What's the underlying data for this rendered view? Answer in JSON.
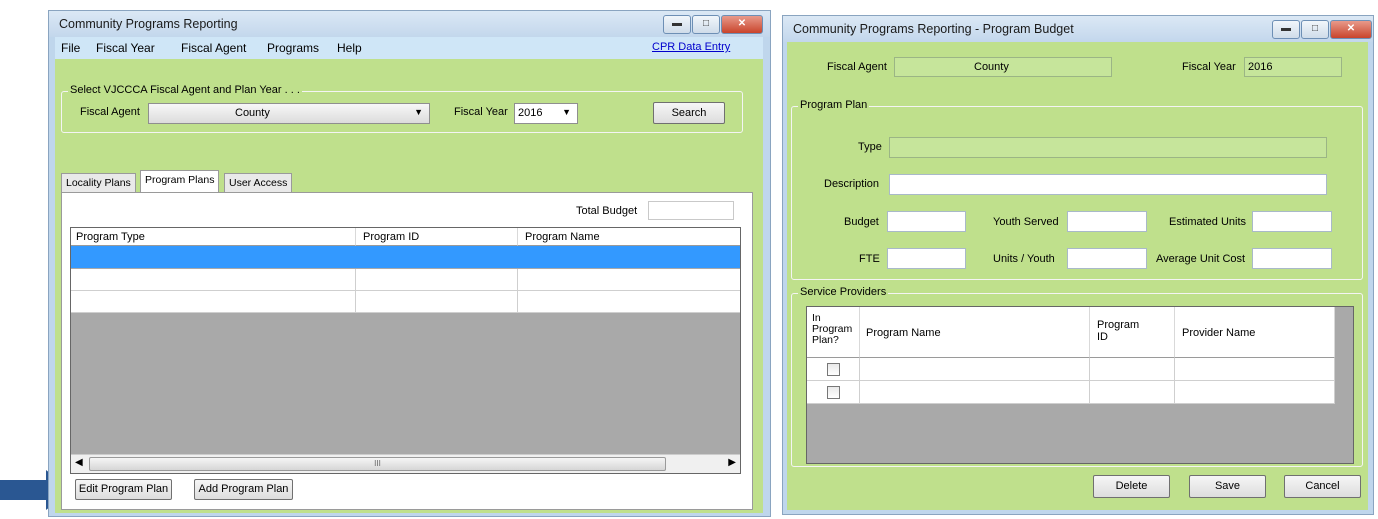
{
  "left_window": {
    "title": "Community Programs Reporting",
    "menu": [
      "File",
      "Fiscal Year",
      "Fiscal Agent",
      "Programs",
      "Help"
    ],
    "data_entry_link": "CPR Data Entry",
    "select_group": {
      "label": "Select VJCCCA Fiscal Agent and Plan Year . . .",
      "fiscal_agent_label": "Fiscal Agent",
      "fiscal_agent_value": "County",
      "fiscal_year_label": "Fiscal Year",
      "fiscal_year_value": "2016",
      "search_label": "Search"
    },
    "tabs": [
      "Locality Plans",
      "Program Plans",
      "User Access"
    ],
    "total_budget_label": "Total Budget",
    "grid_columns": [
      "Program Type",
      "Program ID",
      "Program Name"
    ],
    "scrollbar_grip": "III",
    "edit_button": "Edit Program Plan",
    "add_button": "Add Program Plan"
  },
  "right_window": {
    "title": "Community Programs Reporting - Program Budget",
    "fiscal_agent_label": "Fiscal Agent",
    "fiscal_agent_value": "County",
    "fiscal_year_label": "Fiscal Year",
    "fiscal_year_value": "2016",
    "program_plan": {
      "label": "Program Plan",
      "type_label": "Type",
      "description_label": "Description",
      "budget_label": "Budget",
      "youth_served_label": "Youth Served",
      "estimated_units_label": "Estimated Units",
      "fte_label": "FTE",
      "units_youth_label": "Units / Youth",
      "average_unit_cost_label": "Average Unit Cost"
    },
    "service_providers": {
      "label": "Service Providers",
      "col_in_plan": "In Program Plan?",
      "col_program_name": "Program Name",
      "col_program_id": "Program ID",
      "col_provider_name": "Provider Name"
    },
    "delete_button": "Delete",
    "save_button": "Save",
    "cancel_button": "Cancel"
  },
  "colors": {
    "form_green": "#bfe08c",
    "selection_blue": "#3399ff",
    "arrow_blue": "#2a5792"
  }
}
